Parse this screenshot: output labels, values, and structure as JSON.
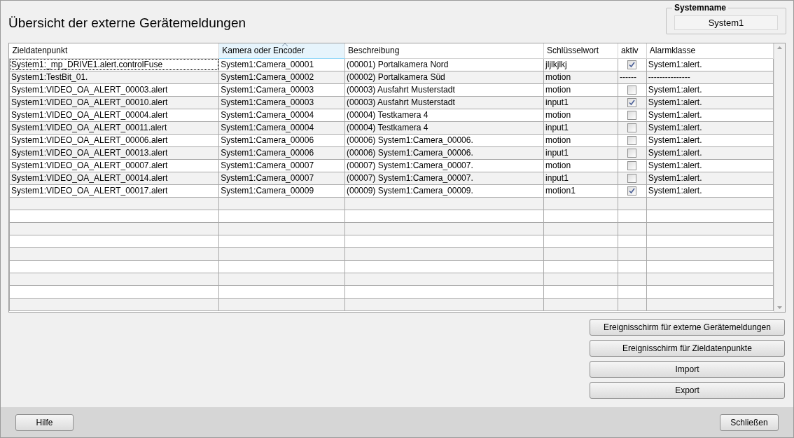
{
  "title": "Übersicht der externe Gerätemeldungen",
  "system": {
    "label": "Systemname",
    "value": "System1"
  },
  "table": {
    "columns": [
      {
        "label": "Zieldatenpunkt",
        "sorted": false
      },
      {
        "label": "Kamera oder Encoder",
        "sorted": true
      },
      {
        "label": "Beschreibung",
        "sorted": false
      },
      {
        "label": "Schlüsselwort",
        "sorted": false
      },
      {
        "label": "aktiv",
        "sorted": false
      },
      {
        "label": "Alarmklasse",
        "sorted": false
      }
    ],
    "rows": [
      {
        "target": "System1:_mp_DRIVE1.alert.controlFuse",
        "camera": "System1:Camera_00001",
        "description": "(00001) Portalkamera Nord",
        "keyword": "jljlkjlkj",
        "aktiv": {
          "kind": "checkbox",
          "checked": true
        },
        "alarm_class": "System1:alert.",
        "focused": true
      },
      {
        "target": "System1:TestBit_01.",
        "camera": "System1:Camera_00002",
        "description": "(00002) Portalkamera Süd",
        "keyword": "motion",
        "aktiv": {
          "kind": "text",
          "text": "------"
        },
        "alarm_class": "---------------",
        "focused": false
      },
      {
        "target": "System1:VIDEO_OA_ALERT_00003.alert",
        "camera": "System1:Camera_00003",
        "description": "(00003) Ausfahrt Musterstadt",
        "keyword": "motion",
        "aktiv": {
          "kind": "checkbox",
          "checked": false
        },
        "alarm_class": "System1:alert.",
        "focused": false
      },
      {
        "target": "System1:VIDEO_OA_ALERT_00010.alert",
        "camera": "System1:Camera_00003",
        "description": "(00003) Ausfahrt Musterstadt",
        "keyword": "input1",
        "aktiv": {
          "kind": "checkbox",
          "checked": true
        },
        "alarm_class": "System1:alert.",
        "focused": false
      },
      {
        "target": "System1:VIDEO_OA_ALERT_00004.alert",
        "camera": "System1:Camera_00004",
        "description": "(00004) Testkamera 4",
        "keyword": "motion",
        "aktiv": {
          "kind": "checkbox",
          "checked": false
        },
        "alarm_class": "System1:alert.",
        "focused": false
      },
      {
        "target": "System1:VIDEO_OA_ALERT_00011.alert",
        "camera": "System1:Camera_00004",
        "description": "(00004) Testkamera 4",
        "keyword": "input1",
        "aktiv": {
          "kind": "checkbox",
          "checked": false
        },
        "alarm_class": "System1:alert.",
        "focused": false
      },
      {
        "target": "System1:VIDEO_OA_ALERT_00006.alert",
        "camera": "System1:Camera_00006",
        "description": "(00006) System1:Camera_00006.",
        "keyword": "motion",
        "aktiv": {
          "kind": "checkbox",
          "checked": false
        },
        "alarm_class": "System1:alert.",
        "focused": false
      },
      {
        "target": "System1:VIDEO_OA_ALERT_00013.alert",
        "camera": "System1:Camera_00006",
        "description": "(00006) System1:Camera_00006.",
        "keyword": "input1",
        "aktiv": {
          "kind": "checkbox",
          "checked": false
        },
        "alarm_class": "System1:alert.",
        "focused": false
      },
      {
        "target": "System1:VIDEO_OA_ALERT_00007.alert",
        "camera": "System1:Camera_00007",
        "description": "(00007) System1:Camera_00007.",
        "keyword": "motion",
        "aktiv": {
          "kind": "checkbox",
          "checked": false
        },
        "alarm_class": "System1:alert.",
        "focused": false
      },
      {
        "target": "System1:VIDEO_OA_ALERT_00014.alert",
        "camera": "System1:Camera_00007",
        "description": "(00007) System1:Camera_00007.",
        "keyword": "input1",
        "aktiv": {
          "kind": "checkbox",
          "checked": false
        },
        "alarm_class": "System1:alert.",
        "focused": false
      },
      {
        "target": "System1:VIDEO_OA_ALERT_00017.alert",
        "camera": "System1:Camera_00009",
        "description": "(00009) System1:Camera_00009.",
        "keyword": "motion1",
        "aktiv": {
          "kind": "checkbox",
          "checked": true
        },
        "alarm_class": "System1:alert.",
        "focused": false
      }
    ]
  },
  "actions": [
    "Ereignisschirm für externe Gerätemeldungen",
    "Ereignisschirm für Zieldatenpunkte",
    "Import",
    "Export"
  ],
  "footer": {
    "help": "Hilfe",
    "close": "Schließen"
  }
}
